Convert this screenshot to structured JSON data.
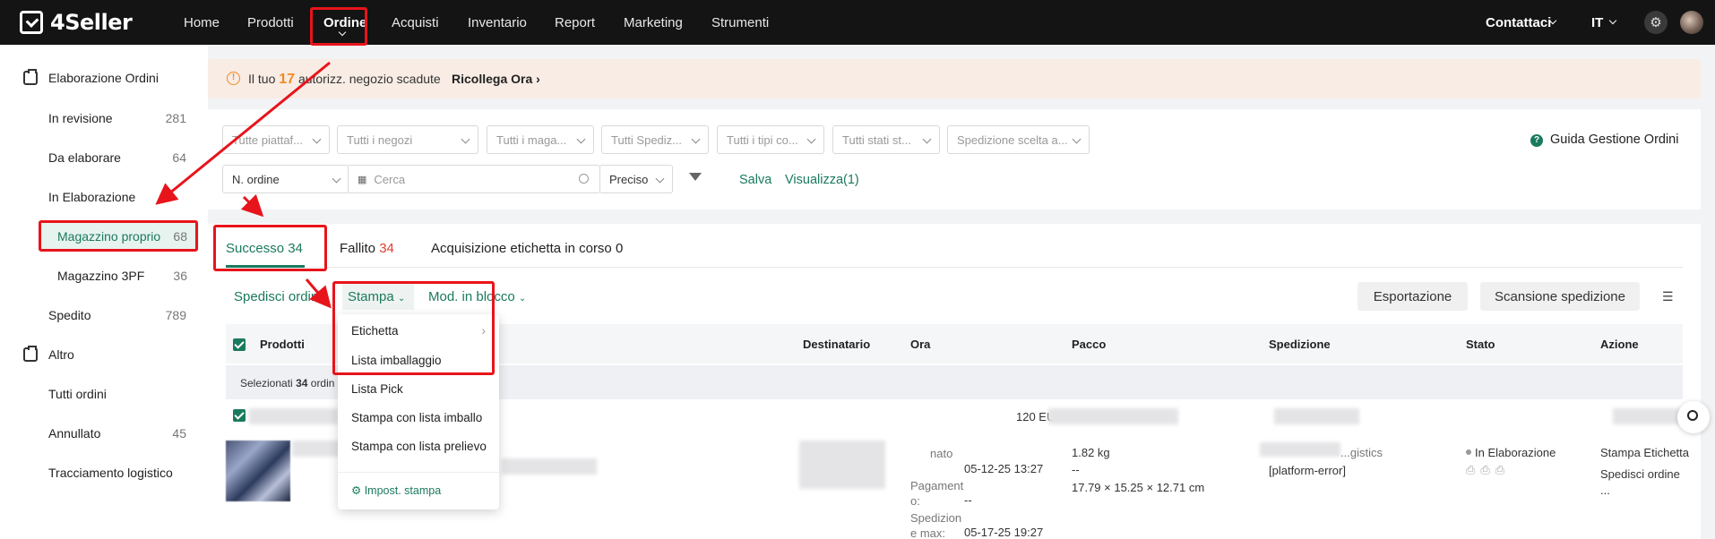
{
  "nav": {
    "logo": "4Seller",
    "items": [
      "Home",
      "Prodotti",
      "Ordine",
      "Acquisti",
      "Inventario",
      "Report",
      "Marketing",
      "Strumenti"
    ],
    "contact": "Contattaci",
    "language": "IT"
  },
  "sidebar": {
    "section1": "Elaborazione Ordini",
    "items": [
      {
        "label": "In revisione",
        "count": "281"
      },
      {
        "label": "Da elaborare",
        "count": "64"
      },
      {
        "label": "In Elaborazione",
        "count": ""
      },
      {
        "label": "Magazzino proprio",
        "count": "68"
      },
      {
        "label": "Magazzino 3PF",
        "count": "36"
      },
      {
        "label": "Spedito",
        "count": "789"
      }
    ],
    "section2": "Altro",
    "items2": [
      {
        "label": "Tutti ordini",
        "count": ""
      },
      {
        "label": "Annullato",
        "count": "45"
      },
      {
        "label": "Tracciamento logistico",
        "count": ""
      }
    ]
  },
  "banner": {
    "prefix": "Il tuo",
    "count": "17",
    "suffix": "autorizz. negozio scadute",
    "link": "Ricollega Ora"
  },
  "filters": {
    "selects": [
      "Tutte piattaf...",
      "Tutti i negozi",
      "Tutti i maga...",
      "Tutti Spediz...",
      "Tutti i tipi co...",
      "Tutti stati st...",
      "Spedizione scelta a..."
    ],
    "guide": "Guida Gestione Ordini",
    "order_type": "N. ordine",
    "search_placeholder": "Cerca",
    "match": "Preciso",
    "save": "Salva",
    "view": "Visualizza(1)"
  },
  "tabs": [
    {
      "label": "Successo",
      "count": "34"
    },
    {
      "label": "Fallito",
      "count": "34"
    },
    {
      "label": "Acquisizione etichetta in corso",
      "count": "0"
    }
  ],
  "toolbar": {
    "ship": "Spedisci ordini",
    "print": "Stampa",
    "bulk": "Mod. in blocco",
    "export": "Esportazione",
    "scan": "Scansione spedizione"
  },
  "table": {
    "headers": [
      "Prodotti",
      "Destinatario",
      "Ora",
      "Pacco",
      "Spedizione",
      "Stato",
      "Azione"
    ],
    "selected_prefix": "Selezionati",
    "selected_count": "34",
    "selected_suffix": "ordin",
    "row1": {
      "amount": "120 EU"
    },
    "row2": {
      "time_label1": "nato",
      "time1": "05-12-25 13:27",
      "time_label2": "Pagament o:",
      "time2": "--",
      "time_label3": "Spedizion e max:",
      "time3": "05-17-25 19:27",
      "weight": "1.82 kg",
      "dash": "--",
      "dims": "17.79 × 15.25 × 12.71 cm",
      "ship_partial": "...gistics",
      "error": "[platform-error]",
      "status": "In Elaborazione",
      "action1": "Stampa Etichetta",
      "action2": "Spedisci ordine",
      "action3": "..."
    }
  },
  "print_menu": {
    "items": [
      "Etichetta",
      "Lista imballaggio",
      "Lista Pick",
      "Stampa con lista imballo",
      "Stampa con lista prelievo"
    ],
    "settings": "Impost. stampa"
  },
  "colors": {
    "brand_green": "#1a7a5e",
    "annotation_red": "#e8141b",
    "nav_bg": "#141414"
  }
}
